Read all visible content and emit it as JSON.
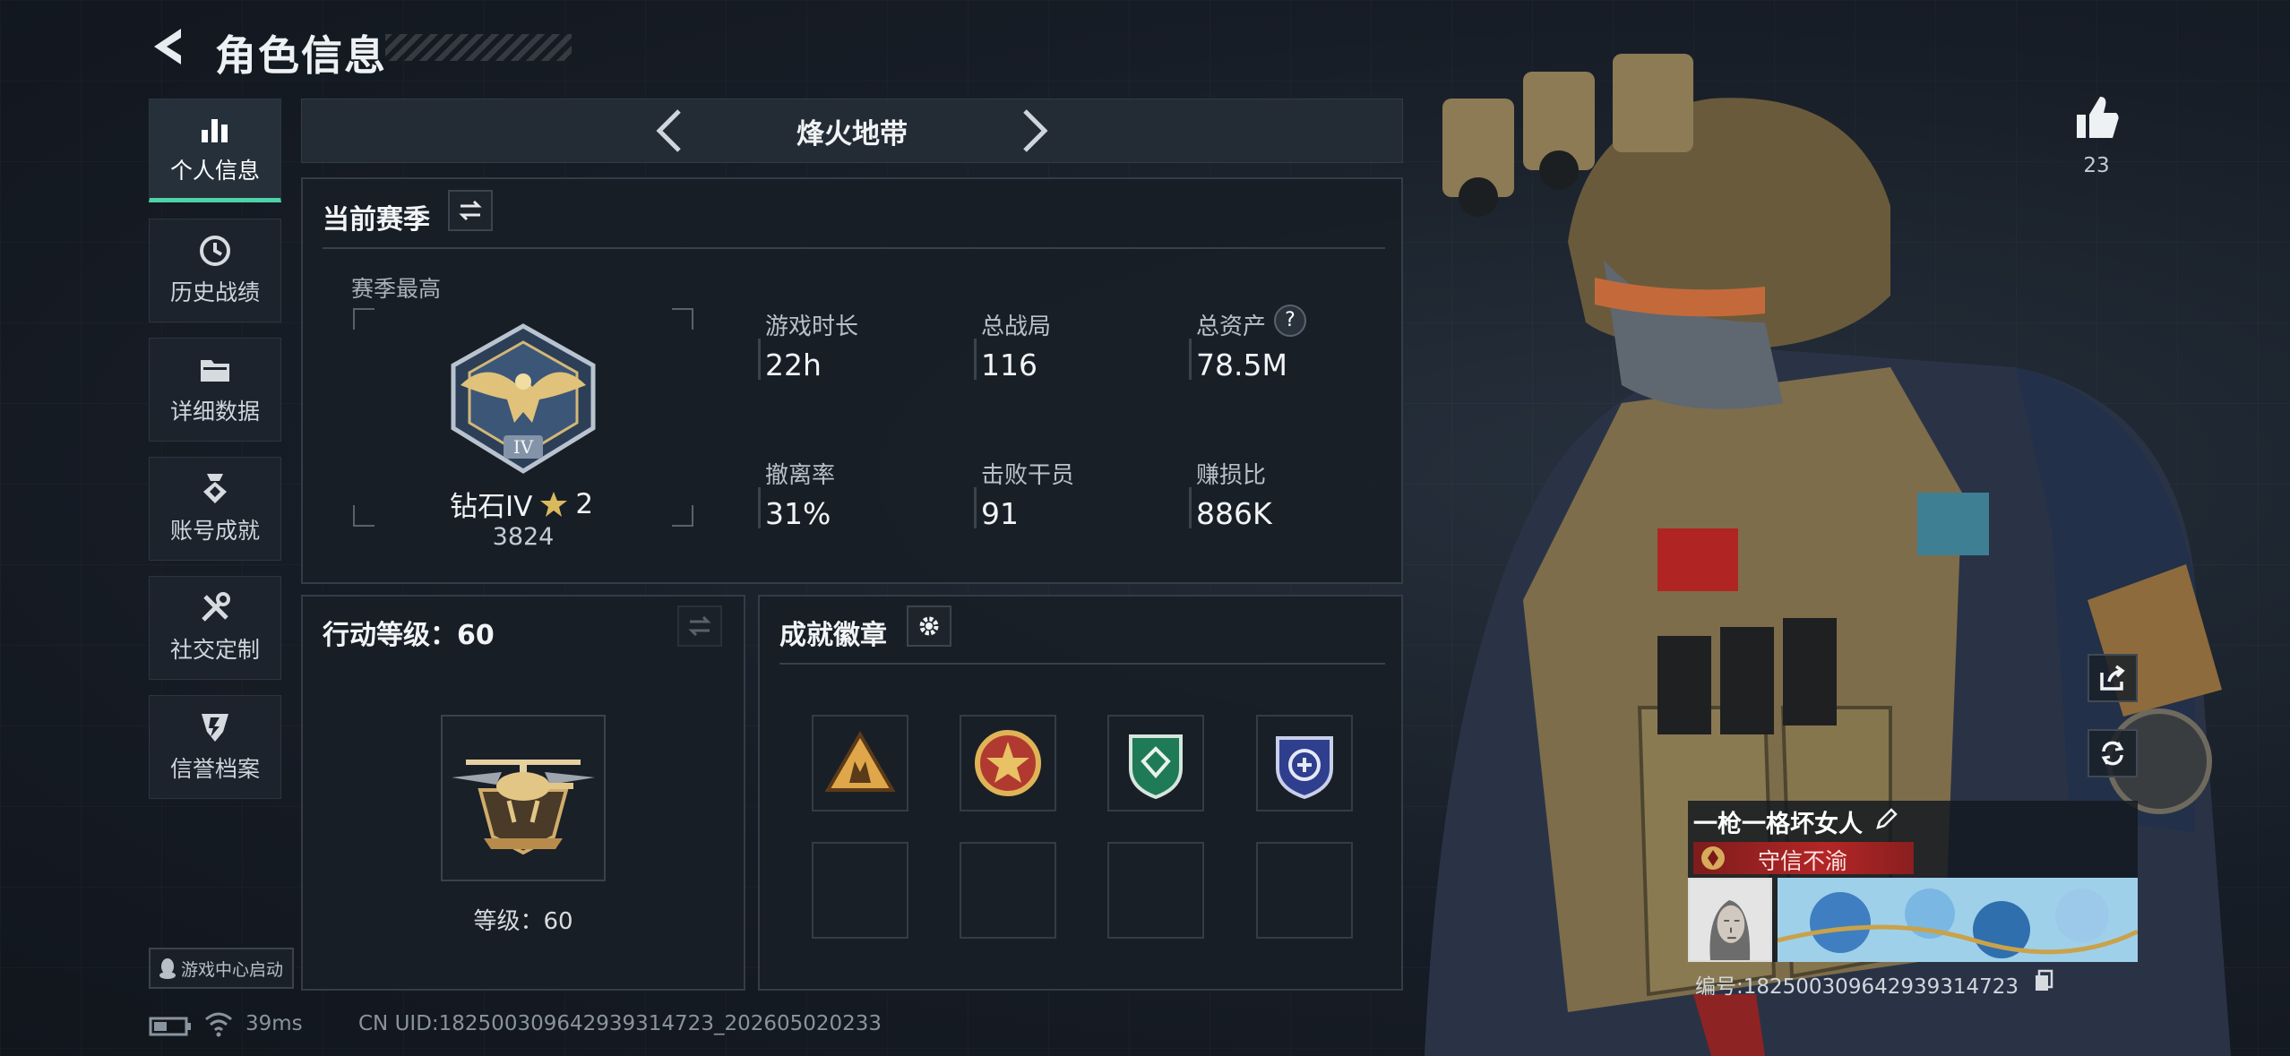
{
  "header": {
    "title": "角色信息"
  },
  "sidebar": {
    "items": [
      {
        "label": "个人信息",
        "icon": "bar-chart-icon",
        "active": true
      },
      {
        "label": "历史战绩",
        "icon": "clock-icon"
      },
      {
        "label": "详细数据",
        "icon": "folder-icon"
      },
      {
        "label": "账号成就",
        "icon": "medal-icon"
      },
      {
        "label": "社交定制",
        "icon": "tools-icon"
      },
      {
        "label": "信誉档案",
        "icon": "shield-icon"
      }
    ],
    "launch_label": "游戏中心启动"
  },
  "mode": {
    "title": "烽火地带"
  },
  "season": {
    "title": "当前赛季",
    "peak_label": "赛季最高",
    "rank_name": "钻石IV",
    "rank_stars": "2",
    "rank_score": "3824",
    "stats": [
      {
        "label": "游戏时长",
        "value": "22h"
      },
      {
        "label": "总战局",
        "value": "116"
      },
      {
        "label": "总资产",
        "value": "78.5M",
        "help": "?"
      },
      {
        "label": "撤离率",
        "value": "31%"
      },
      {
        "label": "击败干员",
        "value": "91"
      },
      {
        "label": "赚损比",
        "value": "886K"
      }
    ]
  },
  "action_level": {
    "title": "行动等级：60",
    "level_label": "等级：60"
  },
  "achievements": {
    "title": "成就徽章",
    "badges": [
      "badge-soldiers-triangle",
      "badge-star-medal",
      "badge-green-shield",
      "badge-blue-shield"
    ]
  },
  "profile": {
    "like_count": "23",
    "player_name": "一枪一格坏女人",
    "honor_title": "守信不渝",
    "player_id": "编号:1825003096429393147​23"
  },
  "footer": {
    "ping": "39ms",
    "uid": "CN UID:182500309642939314723_202605020233"
  },
  "colors": {
    "accent": "#4fd2a8",
    "honor_red": "#b32626",
    "gold": "#d8b564"
  }
}
